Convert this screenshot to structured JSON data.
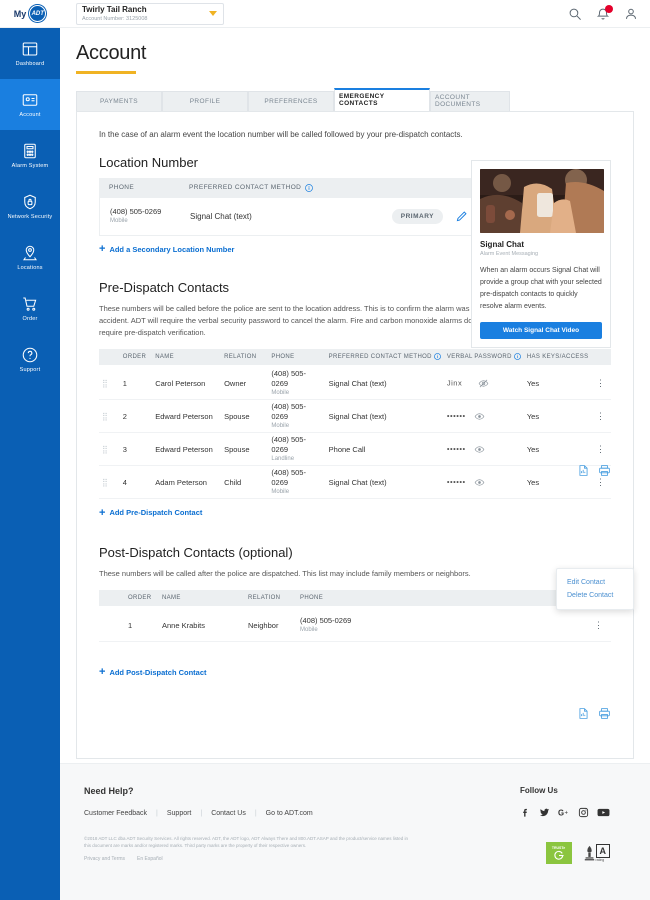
{
  "brand": {
    "logo_my": "My",
    "logo_adt": "ADT",
    "accent_blue": "#0a5fb4",
    "accent_yellow": "#f0b323",
    "link_blue": "#0a6ed1"
  },
  "topbar": {
    "account_name": "Twirly Tail Ranch",
    "account_number": "Account Number: 3125008",
    "icons": {
      "search": "search-icon",
      "notifications": "bell-icon",
      "profile": "user-icon"
    },
    "notification_count": ""
  },
  "sidebar": {
    "items": [
      {
        "label": "Dashboard",
        "icon": "dashboard-icon",
        "active": false
      },
      {
        "label": "Account",
        "icon": "account-icon",
        "active": true
      },
      {
        "label": "Alarm System",
        "icon": "keypad-icon",
        "active": false
      },
      {
        "label": "Network Security",
        "icon": "shield-lock-icon",
        "active": false
      },
      {
        "label": "Locations",
        "icon": "map-pin-icon",
        "active": false
      },
      {
        "label": "Order",
        "icon": "cart-icon",
        "active": false
      },
      {
        "label": "Support",
        "icon": "question-icon",
        "active": false
      }
    ]
  },
  "page": {
    "title": "Account"
  },
  "tabs": [
    {
      "label": "PAYMENTS",
      "active": false
    },
    {
      "label": "PROFILE",
      "active": false
    },
    {
      "label": "PREFERENCES",
      "active": false
    },
    {
      "label": "EMERGENCY CONTACTS",
      "active": true
    },
    {
      "label": "ACCOUNT DOCUMENTS",
      "active": false
    }
  ],
  "main": {
    "intro": "In the case of an alarm event the location number will be called followed by your pre-dispatch contacts.",
    "location": {
      "title": "Location Number",
      "headers": {
        "phone": "PHONE",
        "method": "PREFERRED CONTACT METHOD"
      },
      "row": {
        "phone": "(408) 505-0269",
        "phone_type": "Mobile",
        "method": "Signal Chat (text)",
        "badge": "PRIMARY"
      },
      "add_link": "Add a Secondary Location Number"
    },
    "signal_chat": {
      "title": "Signal Chat",
      "subtitle": "Alarm Event Messaging",
      "body": "When an alarm occurs Signal Chat will provide a group chat with your selected pre-dispatch contacts to quickly resolve alarm events.",
      "button": "Watch Signal Chat Video"
    },
    "pre_dispatch": {
      "title": "Pre-Dispatch Contacts",
      "description": "These numbers will be called before the police are sent to the location address. This is to confirm the alarm was not an accident. ADT will require the verbal security password to cancel the alarm. Fire and carbon monoxide alarms do not require pre-dispatch verification.",
      "headers": [
        "ORDER",
        "NAME",
        "RELATION",
        "PHONE",
        "PREFERRED CONTACT METHOD",
        "VERBAL PASSWORD",
        "HAS KEYS/ACCESS"
      ],
      "rows": [
        {
          "order": "1",
          "name": "Carol Peterson",
          "relation": "Owner",
          "phone": "(408) 505-0269",
          "phone_type": "Mobile",
          "method": "Signal Chat (text)",
          "password": "Jinx",
          "password_visible": true,
          "keys": "Yes"
        },
        {
          "order": "2",
          "name": "Edward Peterson",
          "relation": "Spouse",
          "phone": "(408) 505-0269",
          "phone_type": "Mobile",
          "method": "Signal Chat (text)",
          "password": "••••••",
          "password_visible": false,
          "keys": "Yes"
        },
        {
          "order": "3",
          "name": "Edward  Peterson",
          "relation": "Spouse",
          "phone": "(408) 505-0269",
          "phone_type": "Landline",
          "method": "Phone Call",
          "password": "••••••",
          "password_visible": false,
          "keys": "Yes"
        },
        {
          "order": "4",
          "name": "Adam Peterson",
          "relation": "Child",
          "phone": "(408) 505-0269",
          "phone_type": "Mobile",
          "method": "Signal Chat (text)",
          "password": "••••••",
          "password_visible": false,
          "keys": "Yes"
        }
      ],
      "add_link": "Add Pre-Dispatch Contact"
    },
    "context_menu": {
      "edit": "Edit Contact",
      "delete": "Delete Contact"
    },
    "post_dispatch": {
      "title": "Post-Dispatch Contacts (optional)",
      "description": "These numbers will be called after the police are dispatched. This list may include family members or neighbors.",
      "headers": [
        "ORDER",
        "NAME",
        "RELATION",
        "PHONE"
      ],
      "rows": [
        {
          "order": "1",
          "name": "Anne Krabits",
          "relation": "Neighbor",
          "phone": "(408) 505-0269",
          "phone_type": "Mobile"
        }
      ],
      "add_link": "Add Post-Dispatch Contact"
    }
  },
  "footer": {
    "need_help": "Need Help?",
    "links": [
      "Customer Feedback",
      "Support",
      "Contact Us",
      "Go to ADT.com"
    ],
    "follow_us": "Follow Us",
    "social": [
      "facebook-icon",
      "twitter-icon",
      "google-plus-icon",
      "instagram-icon",
      "youtube-icon"
    ],
    "legal": "©2018 ADT LLC dba ADT Security Services. All rights reserved. ADT, the ADT logo, ADT Always There and 800.ADT.ASAP and the product/service names listed in this document are marks and/or registered marks. Third party marks are the property of their respective owners.",
    "privacy": "Privacy and Terms",
    "espanol": "En Español",
    "truste_top": "TRUSTe",
    "bbb_letter": "A",
    "bbb_rating": "rating"
  }
}
